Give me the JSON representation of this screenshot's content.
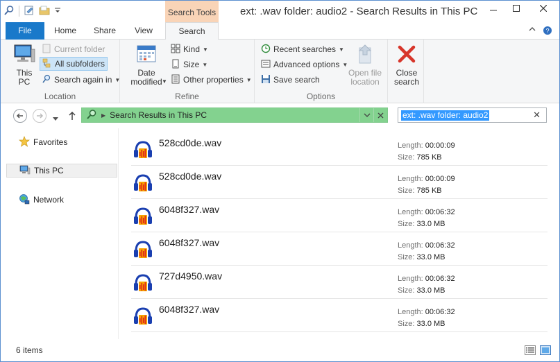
{
  "window": {
    "title": "ext: .wav folder: audio2 - Search Results in This PC",
    "context_tab_title": "Search Tools"
  },
  "tabs": [
    {
      "label": "File"
    },
    {
      "label": "Home"
    },
    {
      "label": "Share"
    },
    {
      "label": "View"
    },
    {
      "label": "Search"
    }
  ],
  "ribbon": {
    "location": {
      "label": "Location",
      "this_pc": "This PC",
      "current_folder": "Current folder",
      "all_subfolders": "All subfolders",
      "search_again_in": "Search again in"
    },
    "refine": {
      "label": "Refine",
      "date_modified": "Date modified",
      "kind": "Kind",
      "size": "Size",
      "other_properties": "Other properties"
    },
    "options": {
      "label": "Options",
      "recent_searches": "Recent searches",
      "advanced_options": "Advanced options",
      "save_search": "Save search",
      "open_file_location": "Open file location"
    },
    "close": {
      "close_search": "Close search"
    }
  },
  "address": {
    "breadcrumb": "Search Results in This PC",
    "search_query": "ext: .wav folder: audio2"
  },
  "nav": {
    "favorites": "Favorites",
    "this_pc": "This PC",
    "network": "Network"
  },
  "files": [
    {
      "name": "528cd0de.wav",
      "length_label": "Length:",
      "length": "00:00:09",
      "size_label": "Size:",
      "size": "785 KB"
    },
    {
      "name": "528cd0de.wav",
      "length_label": "Length:",
      "length": "00:00:09",
      "size_label": "Size:",
      "size": "785 KB"
    },
    {
      "name": "6048f327.wav",
      "length_label": "Length:",
      "length": "00:06:32",
      "size_label": "Size:",
      "size": "33.0 MB"
    },
    {
      "name": "6048f327.wav",
      "length_label": "Length:",
      "length": "00:06:32",
      "size_label": "Size:",
      "size": "33.0 MB"
    },
    {
      "name": "727d4950.wav",
      "length_label": "Length:",
      "length": "00:06:32",
      "size_label": "Size:",
      "size": "33.0 MB"
    },
    {
      "name": "6048f327.wav",
      "length_label": "Length:",
      "length": "00:06:32",
      "size_label": "Size:",
      "size": "33.0 MB"
    }
  ],
  "status": {
    "item_count": "6 items"
  },
  "colors": {
    "file_tab": "#1979ca",
    "context_tab": "#f9d4b7",
    "address_bar_search": "#83d28f",
    "selection": "#3399ff"
  },
  "icons": {
    "file_icon": "audacity-headphones-icon"
  }
}
